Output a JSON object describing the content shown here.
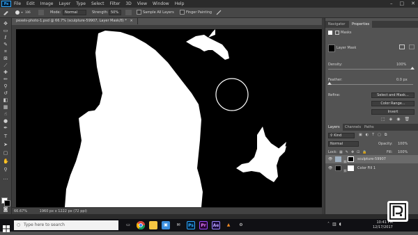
{
  "menubar": {
    "app_logo": "Ps",
    "menus": [
      "File",
      "Edit",
      "Image",
      "Layer",
      "Type",
      "Select",
      "Filter",
      "3D",
      "View",
      "Window",
      "Help"
    ],
    "window_controls": [
      "–",
      "□",
      "✕"
    ]
  },
  "options": {
    "mode_label": "Mode:",
    "mode_value": "Normal",
    "strength_label": "Strength:",
    "strength_value": "50%",
    "sample_all_layers": "Sample All Layers",
    "finger_painting": "Finger Painting",
    "brush_size": "106"
  },
  "document": {
    "tab_title": "pexels-photo-1.psd @ 66.7% (sculpture-59907, Layer Mask/8) *",
    "zoom": "66.67%",
    "doc_info": "1960 px x 1222 px (72 ppi)"
  },
  "panels": {
    "top_tabs": [
      "Navigator",
      "Properties"
    ],
    "properties": {
      "masks_title": "Masks",
      "layer_mask": "Layer Mask",
      "density_label": "Density:",
      "density_value": "100%",
      "feather_label": "Feather:",
      "feather_value": "0.0 px",
      "refine_label": "Refine:",
      "select_and_mask": "Select and Mask...",
      "color_range": "Color Range...",
      "invert": "Invert"
    },
    "layers_tabs": [
      "Layers",
      "Channels",
      "Paths"
    ],
    "layers": {
      "kind_label": "Kind",
      "blend_mode": "Normal",
      "opacity_label": "Opacity:",
      "opacity_value": "100%",
      "lock_label": "Lock:",
      "fill_label": "Fill:",
      "fill_value": "100%",
      "items": [
        {
          "name": "sculpture-59907"
        },
        {
          "name": "Color Fill 1"
        }
      ]
    }
  },
  "taskbar": {
    "search_placeholder": "Type here to search",
    "time": "10:41 PM",
    "date": "12/17/2017",
    "apps": [
      "Ps",
      "Pr",
      "Ae"
    ],
    "watermark": "P"
  }
}
